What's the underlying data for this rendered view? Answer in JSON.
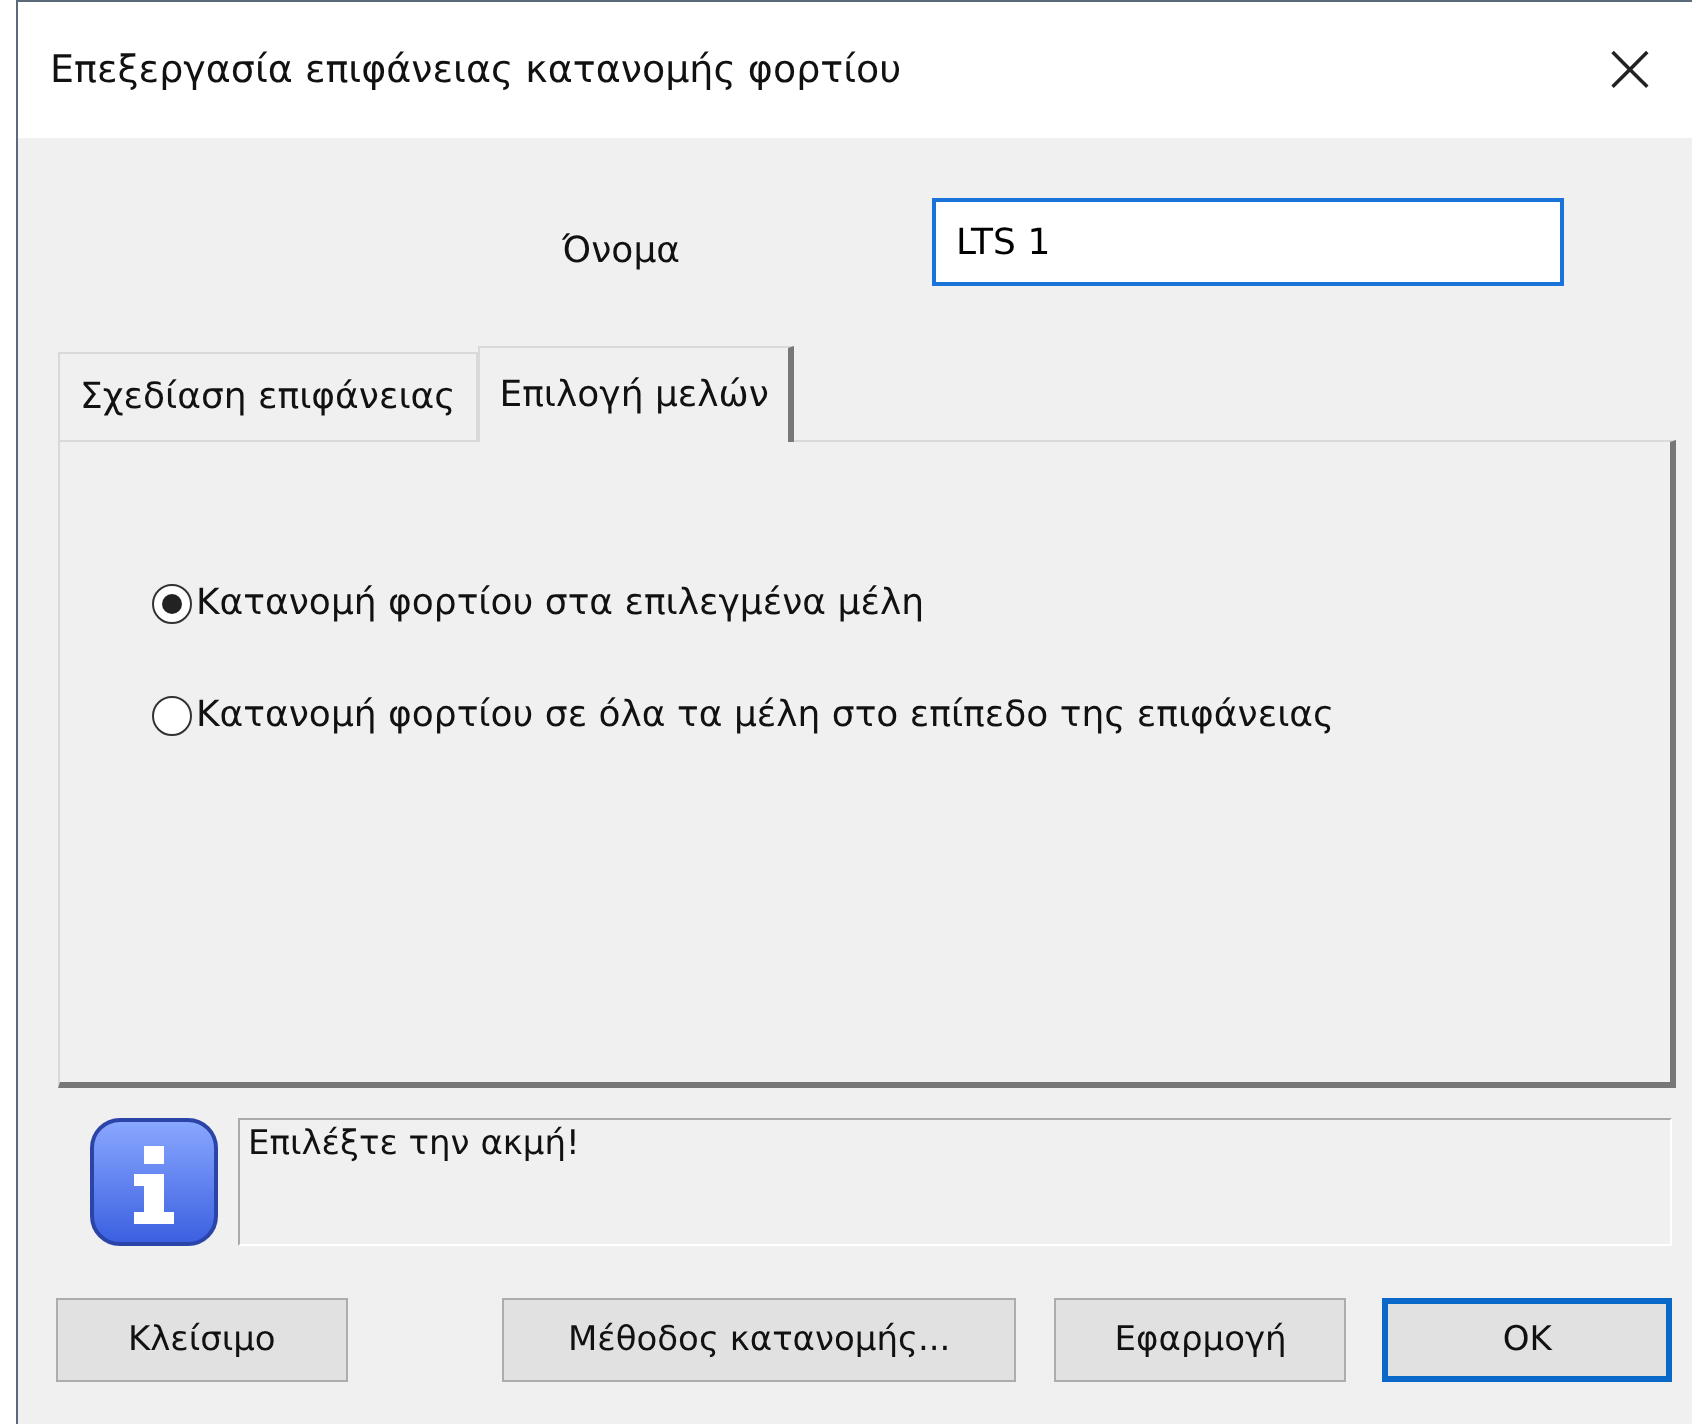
{
  "window": {
    "title": "Επεξεργασία επιφάνειας κατανομής φορτίου",
    "close": "×"
  },
  "name_field": {
    "label": "Όνομα",
    "value": "LTS 1"
  },
  "tabs": [
    {
      "label": "Σχεδίαση επιφάνειας",
      "selected": false
    },
    {
      "label": "Επιλογή μελών",
      "selected": true
    }
  ],
  "options": [
    {
      "label": "Κατανομή φορτίου στα επιλεγμένα μέλη",
      "selected": true
    },
    {
      "label": "Κατανομή φορτίου σε όλα τα μέλη στο επίπεδο της επιφάνειας",
      "selected": false
    }
  ],
  "message": {
    "text": "Επιλέξτε την ακμή!"
  },
  "buttons": [
    {
      "label": "Κλείσιμο",
      "default": false
    },
    {
      "label": "Μέθοδος κατανομής...",
      "default": false
    },
    {
      "label": "Εφαρμογή",
      "default": false
    },
    {
      "label": "OK",
      "default": true
    }
  ]
}
